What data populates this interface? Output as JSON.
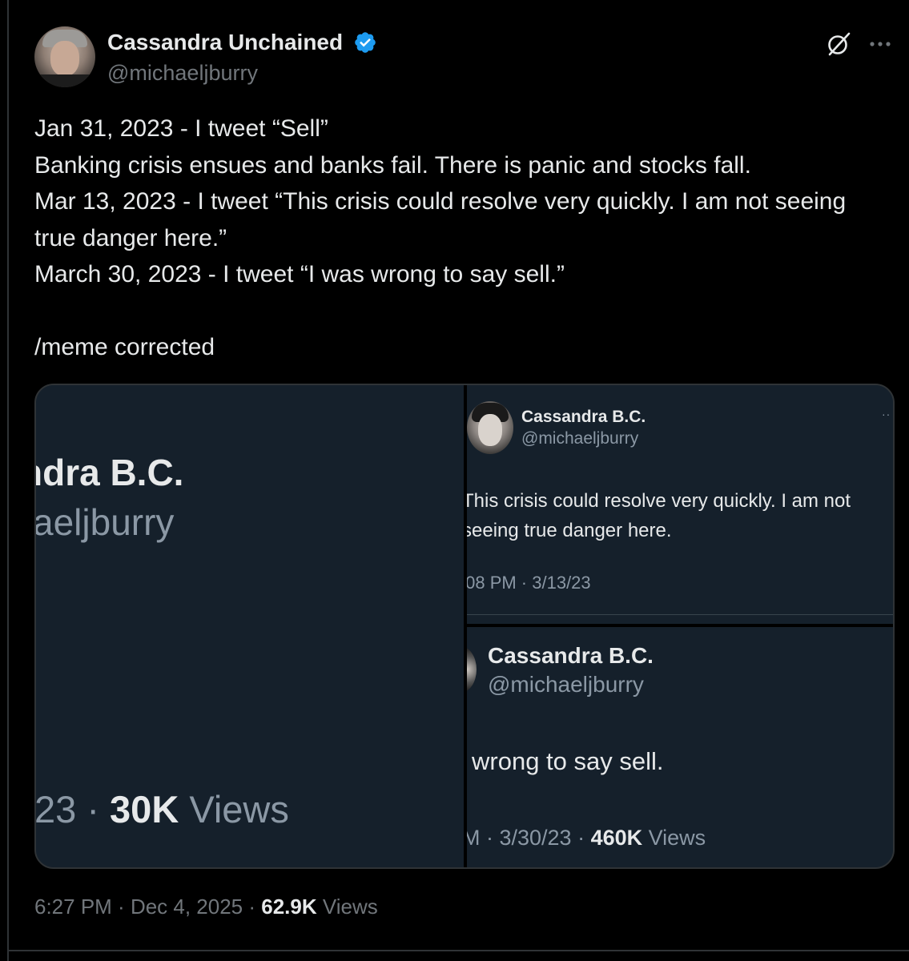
{
  "tweet": {
    "author_name": "Cassandra Unchained",
    "author_handle": "@michaeljburry",
    "verified_color": "#1d9bf0",
    "header_icons": [
      "grok-icon",
      "more-icon"
    ],
    "body": "Jan 31, 2023 - I tweet “Sell”\nBanking crisis ensues and banks fail. There is panic and stocks fall.\nMar 13, 2023 - I tweet “This crisis could resolve very quickly. I am not seeing true danger here.”\nMarch 30, 2023 - I tweet “I was wrong to say sell.”\n\n/meme corrected",
    "footer": {
      "time": "6:27 PM",
      "sep1": " · ",
      "date": "Dec 4, 2025",
      "sep2": " · ",
      "views_count": "62.9K",
      "views_label": " Views"
    }
  },
  "media": {
    "left": {
      "name": "ndra B.C.",
      "handle": "aeljburry",
      "meta_prefix": "23 · ",
      "views_count": "30K",
      "views_label": " Views"
    },
    "right_top": {
      "name": "Cassandra B.C.",
      "handle": "@michaeljburry",
      "dots": "··",
      "text": "This crisis could resolve very quickly. I am not\nseeing true danger here.",
      "meta": ":08 PM · 3/13/23"
    },
    "right_bottom": {
      "name": "Cassandra B.C.",
      "handle": "@michaeljburry",
      "text": "wrong to say sell.",
      "meta_prefix": "M · 3/30/23 · ",
      "views_count": "460K",
      "views_label": " Views"
    }
  }
}
